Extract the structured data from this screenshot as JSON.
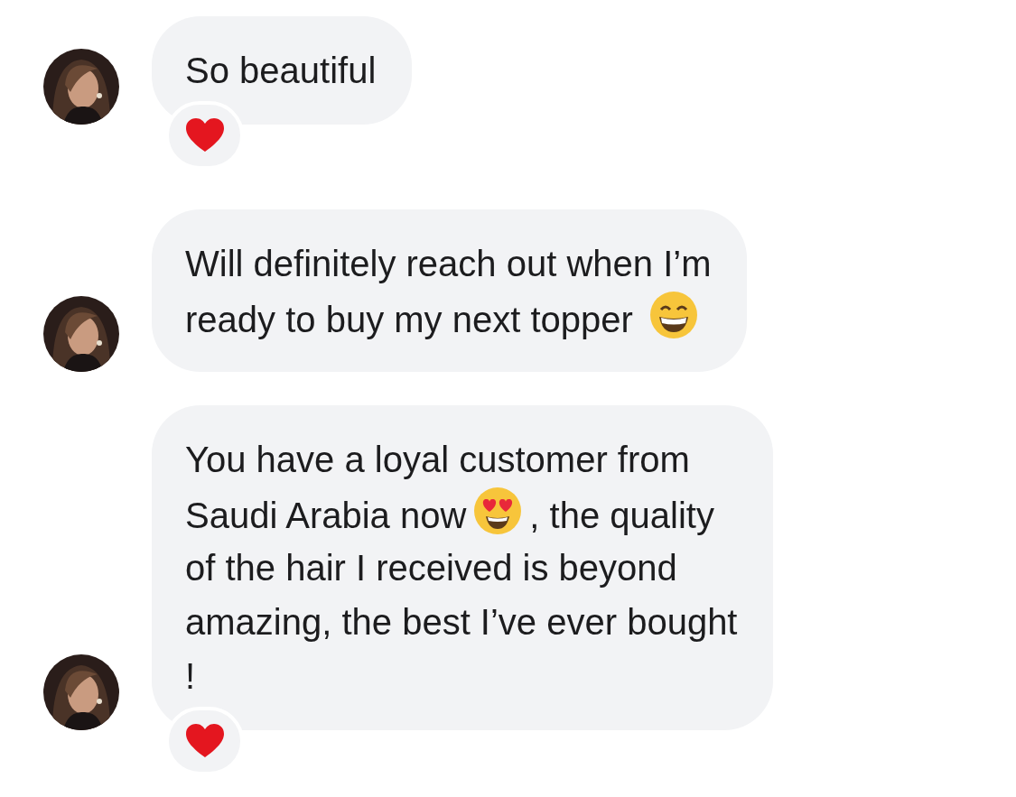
{
  "messages": [
    {
      "avatar": {
        "kind": "picture"
      },
      "lines": [
        [
          {
            "kind": "text",
            "text": "So beautiful"
          }
        ]
      ],
      "reaction": {
        "kind": "heart"
      }
    },
    {
      "avatar": {
        "kind": "picture"
      },
      "lines": [
        [
          {
            "kind": "text",
            "text": "Will definitely reach out when I’m"
          }
        ],
        [
          {
            "kind": "text",
            "text": "ready to buy my next topper"
          },
          {
            "kind": "grin-emoji"
          }
        ]
      ]
    },
    {
      "avatar": {
        "kind": "picture"
      },
      "lines": [
        [
          {
            "kind": "text",
            "text": "You have a loyal customer from"
          }
        ],
        [
          {
            "kind": "text",
            "text": "Saudi Arabia now"
          },
          {
            "kind": "hearteyes-emoji"
          },
          {
            "kind": "text",
            "text": ", the quality"
          }
        ],
        [
          {
            "kind": "text",
            "text": "of the hair I received is beyond"
          }
        ],
        [
          {
            "kind": "text",
            "text": "amazing, the best I’ve ever bought"
          }
        ],
        [
          {
            "kind": "text",
            "text": "!"
          }
        ]
      ],
      "reaction": {
        "kind": "heart"
      }
    }
  ]
}
